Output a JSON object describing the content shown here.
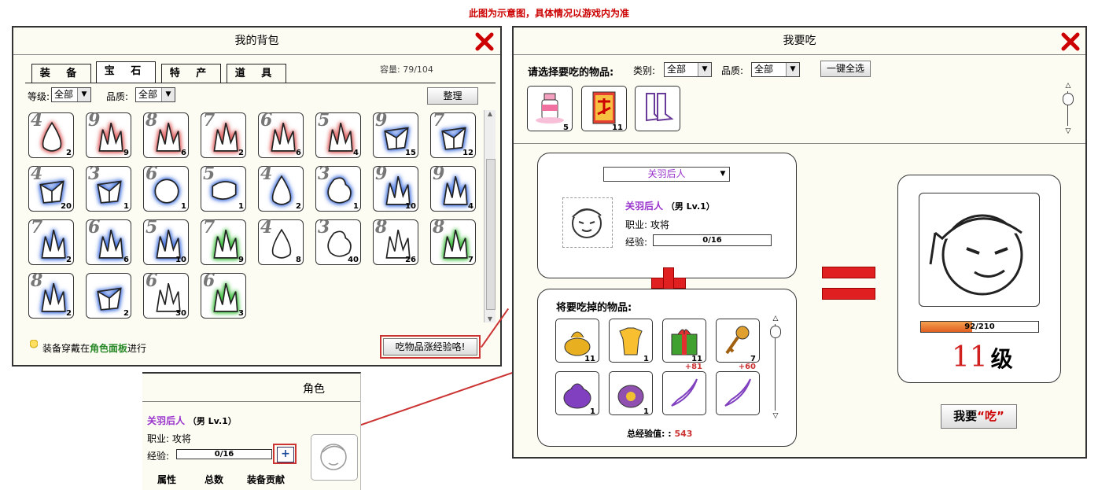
{
  "notice": "此图为示意图，具体情况以游戏内为准",
  "bag": {
    "title": "我的背包",
    "tabs": [
      "装 备",
      "宝 石",
      "特 产",
      "道 具"
    ],
    "capacity": "容量: 79/104",
    "level_label": "等级:",
    "level_value": "全部",
    "quality_label": "品质:",
    "quality_value": "全部",
    "sort_button": "整理",
    "tip_prefix": "装备穿戴在",
    "tip_link": "角色面板",
    "tip_suffix": "进行",
    "eat_button": "吃物品涨经验咯!",
    "gems": [
      {
        "lv": "4",
        "count": "2",
        "glow": "#e06060"
      },
      {
        "lv": "9",
        "count": "9",
        "glow": "#e06060"
      },
      {
        "lv": "8",
        "count": "6",
        "glow": "#e06060"
      },
      {
        "lv": "7",
        "count": "2",
        "glow": "#e06060"
      },
      {
        "lv": "6",
        "count": "6",
        "glow": "#e06060"
      },
      {
        "lv": "5",
        "count": "4",
        "glow": "#e06060"
      },
      {
        "lv": "9",
        "count": "15",
        "glow": "#4a78e0"
      },
      {
        "lv": "7",
        "count": "12",
        "glow": "#4a78e0"
      },
      {
        "lv": "4",
        "count": "20",
        "glow": "#4a78e0"
      },
      {
        "lv": "3",
        "count": "1",
        "glow": "#4a78e0"
      },
      {
        "lv": "6",
        "count": "1",
        "glow": "#4a78e0"
      },
      {
        "lv": "5",
        "count": "1",
        "glow": "#4a78e0"
      },
      {
        "lv": "4",
        "count": "2",
        "glow": "#4a78e0"
      },
      {
        "lv": "3",
        "count": "1",
        "glow": "#4a78e0"
      },
      {
        "lv": "9",
        "count": "10",
        "glow": "#4a78e0"
      },
      {
        "lv": "9",
        "count": "4",
        "glow": "#4a78e0"
      },
      {
        "lv": "7",
        "count": "2",
        "glow": "#4a78e0"
      },
      {
        "lv": "6",
        "count": "6",
        "glow": "#4a78e0"
      },
      {
        "lv": "5",
        "count": "10",
        "glow": "#4a78e0"
      },
      {
        "lv": "7",
        "count": "9",
        "glow": "#40c040"
      },
      {
        "lv": "4",
        "count": "8",
        "glow": "none"
      },
      {
        "lv": "3",
        "count": "40",
        "glow": "none"
      },
      {
        "lv": "8",
        "count": "26",
        "glow": "none"
      },
      {
        "lv": "8",
        "count": "7",
        "glow": "#40c040"
      },
      {
        "lv": "8",
        "count": "2",
        "glow": "#4a78e0"
      },
      {
        "lv": "",
        "count": "2",
        "glow": "#4a78e0"
      },
      {
        "lv": "6",
        "count": "30",
        "glow": "none"
      },
      {
        "lv": "6",
        "count": "3",
        "glow": "#40c040"
      }
    ]
  },
  "eat": {
    "title": "我要吃",
    "choose_label": "请选择要吃的物品:",
    "category_label": "类别:",
    "category_value": "全部",
    "quality_label": "品质:",
    "quality_value": "全部",
    "select_all": "一键全选",
    "top_items": [
      {
        "count": "5"
      },
      {
        "count": "11"
      },
      {
        "count": ""
      }
    ],
    "character_select": "关羽后人",
    "char_name": "关羽后人",
    "char_gender_lv": "（男 Lv.1）",
    "job_label": "职业:",
    "job_value": "攻将",
    "exp_label": "经验:",
    "exp_value": "0/16",
    "exp_fill": 0,
    "to_eat_label": "将要吃掉的物品:",
    "items": [
      {
        "count": "11",
        "plus": ""
      },
      {
        "count": "1",
        "plus": ""
      },
      {
        "count": "11",
        "plus": ""
      },
      {
        "count": "7",
        "plus": ""
      },
      {
        "count": "1",
        "plus": ""
      },
      {
        "count": "1",
        "plus": ""
      },
      {
        "count": "",
        "plus": "+81"
      },
      {
        "count": "",
        "plus": "+60"
      }
    ],
    "total_label": "总经验值: :",
    "total_value": "543",
    "result_exp": "92/210",
    "result_exp_fill": 0.438,
    "result_level_num": "11",
    "result_level_unit": "级",
    "eat_button_a": "我要",
    "eat_button_b": "“吃”"
  },
  "role": {
    "title": "角色",
    "name": "关羽后人",
    "gender_lv": "（男 Lv.1）",
    "job_label": "职业:",
    "job_value": "攻将",
    "exp_label": "经验:",
    "exp_value": "0/16",
    "col_attr": "属性",
    "col_total": "总数",
    "col_equip": "装备贡献"
  }
}
